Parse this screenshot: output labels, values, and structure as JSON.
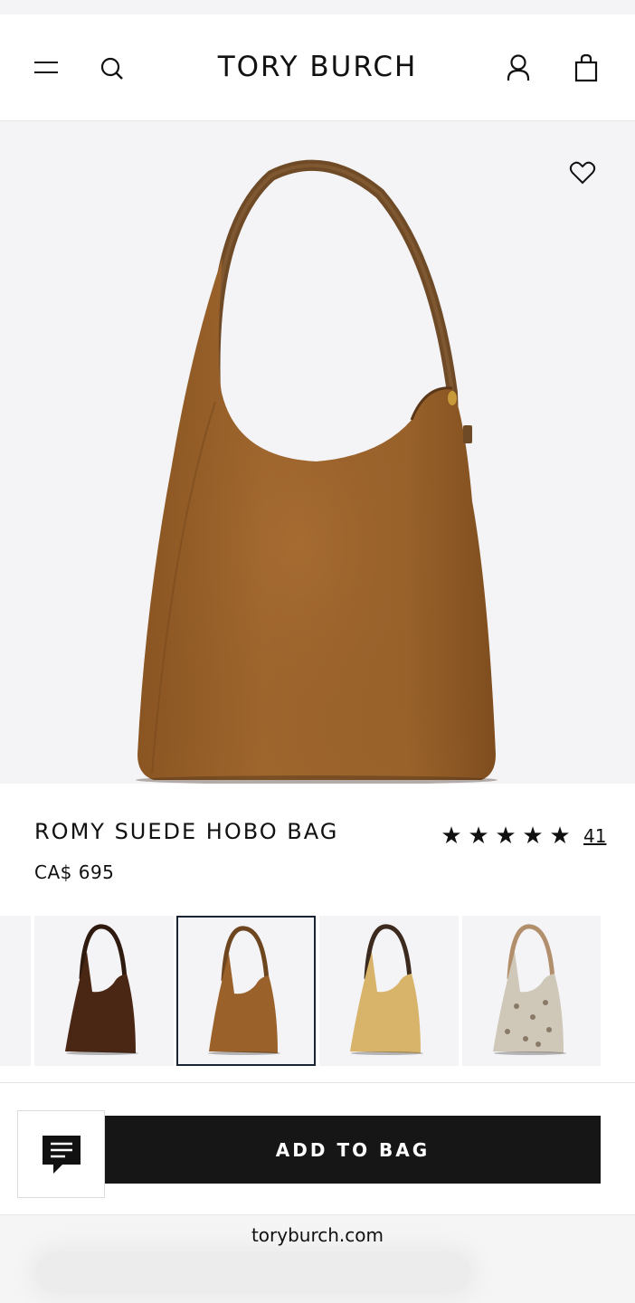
{
  "header": {
    "brand": "TORY BURCH",
    "icons": [
      "menu-icon",
      "search-icon",
      "account-icon",
      "shopping-bag-icon"
    ]
  },
  "hero": {
    "wishlist_icon": "heart-icon",
    "bag_color": "#9a622a"
  },
  "product": {
    "name": "ROMY SUEDE HOBO BAG",
    "price": "CA$ 695",
    "rating": 5,
    "stars": [
      "★",
      "★",
      "★",
      "★",
      "★"
    ],
    "review_count": "41"
  },
  "swatches": {
    "selected_index": 1,
    "items": [
      {
        "color": "#4a2614",
        "strap": "#2f1a10"
      },
      {
        "color": "#9a622a",
        "strap": "#6d451f"
      },
      {
        "color": "#d8b46a",
        "strap": "#3b2a1d"
      },
      {
        "color": "#cfc7b8",
        "strap": "#b28f6c"
      }
    ]
  },
  "actions": {
    "chat_icon": "chat-icon",
    "add_to_bag": "ADD TO BAG"
  },
  "browser": {
    "url": "toryburch.com"
  }
}
